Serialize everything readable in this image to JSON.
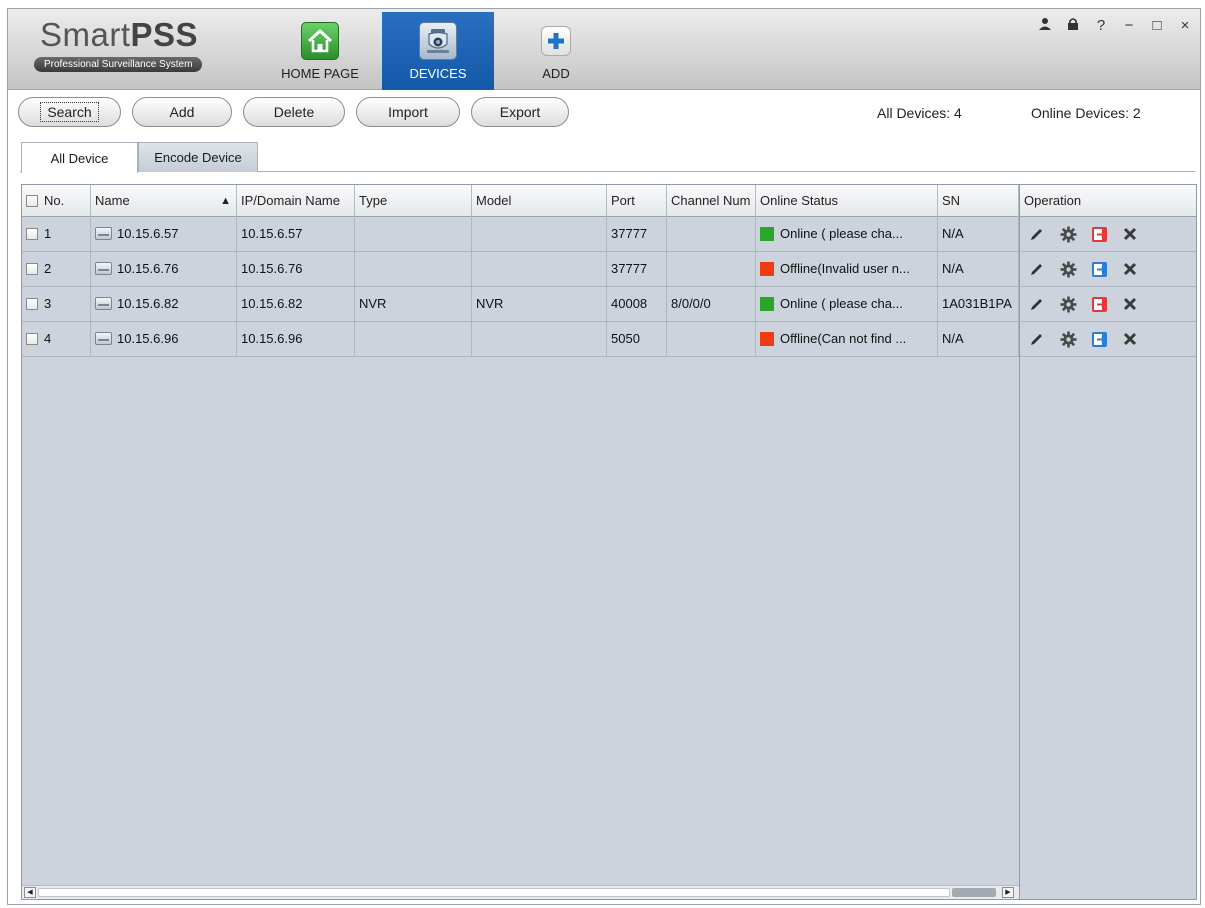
{
  "app": {
    "logo_name": "SmartPSS",
    "logo_tagline": "Professional Surveillance System"
  },
  "nav": [
    {
      "label": "HOME PAGE",
      "icon": "home-icon",
      "active": false
    },
    {
      "label": "DEVICES",
      "icon": "camera-icon",
      "active": true
    },
    {
      "label": "ADD",
      "icon": "plus-icon",
      "active": false
    }
  ],
  "window_controls": {
    "user": "user-icon",
    "lock": "lock-icon",
    "help": "?",
    "minimize": "−",
    "maximize": "□",
    "close": "×"
  },
  "toolbar": {
    "search": "Search",
    "add": "Add",
    "delete": "Delete",
    "import": "Import",
    "export": "Export"
  },
  "counts": {
    "all_devices": "All Devices:  4",
    "online_devices": "Online Devices:  2"
  },
  "tabs": [
    {
      "label": "All Device",
      "active": true
    },
    {
      "label": "Encode Device",
      "active": false
    }
  ],
  "table": {
    "columns": {
      "no": "No.",
      "name": "Name",
      "ip": "IP/Domain Name",
      "type": "Type",
      "model": "Model",
      "port": "Port",
      "channel": "Channel Num",
      "status": "Online Status",
      "sn": "SN",
      "operation": "Operation"
    },
    "sort_indicator": "▲",
    "rows": [
      {
        "no": "1",
        "name": "10.15.6.57",
        "ip": "10.15.6.57",
        "type": "",
        "model": "",
        "port": "37777",
        "channel": "",
        "status": "Online ( please cha...",
        "status_color": "#2aa62a",
        "sn": "N/A",
        "login_color": "#e03a3a"
      },
      {
        "no": "2",
        "name": "10.15.6.76",
        "ip": "10.15.6.76",
        "type": "",
        "model": "",
        "port": "37777",
        "channel": "",
        "status": "Offline(Invalid user n...",
        "status_color": "#f03c10",
        "sn": "N/A",
        "login_color": "#2a7fd4"
      },
      {
        "no": "3",
        "name": "10.15.6.82",
        "ip": "10.15.6.82",
        "type": "NVR",
        "model": "NVR",
        "port": "40008",
        "channel": "8/0/0/0",
        "status": "Online ( please cha...",
        "status_color": "#2aa62a",
        "sn": "1A031B1PA",
        "login_color": "#e03a3a"
      },
      {
        "no": "4",
        "name": "10.15.6.96",
        "ip": "10.15.6.96",
        "type": "",
        "model": "",
        "port": "5050",
        "channel": "",
        "status": "Offline(Can not find ...",
        "status_color": "#f03c10",
        "sn": "N/A",
        "login_color": "#2a7fd4"
      }
    ]
  },
  "scrollbar": {
    "left_arrow": "◀",
    "right_arrow": "▶"
  }
}
